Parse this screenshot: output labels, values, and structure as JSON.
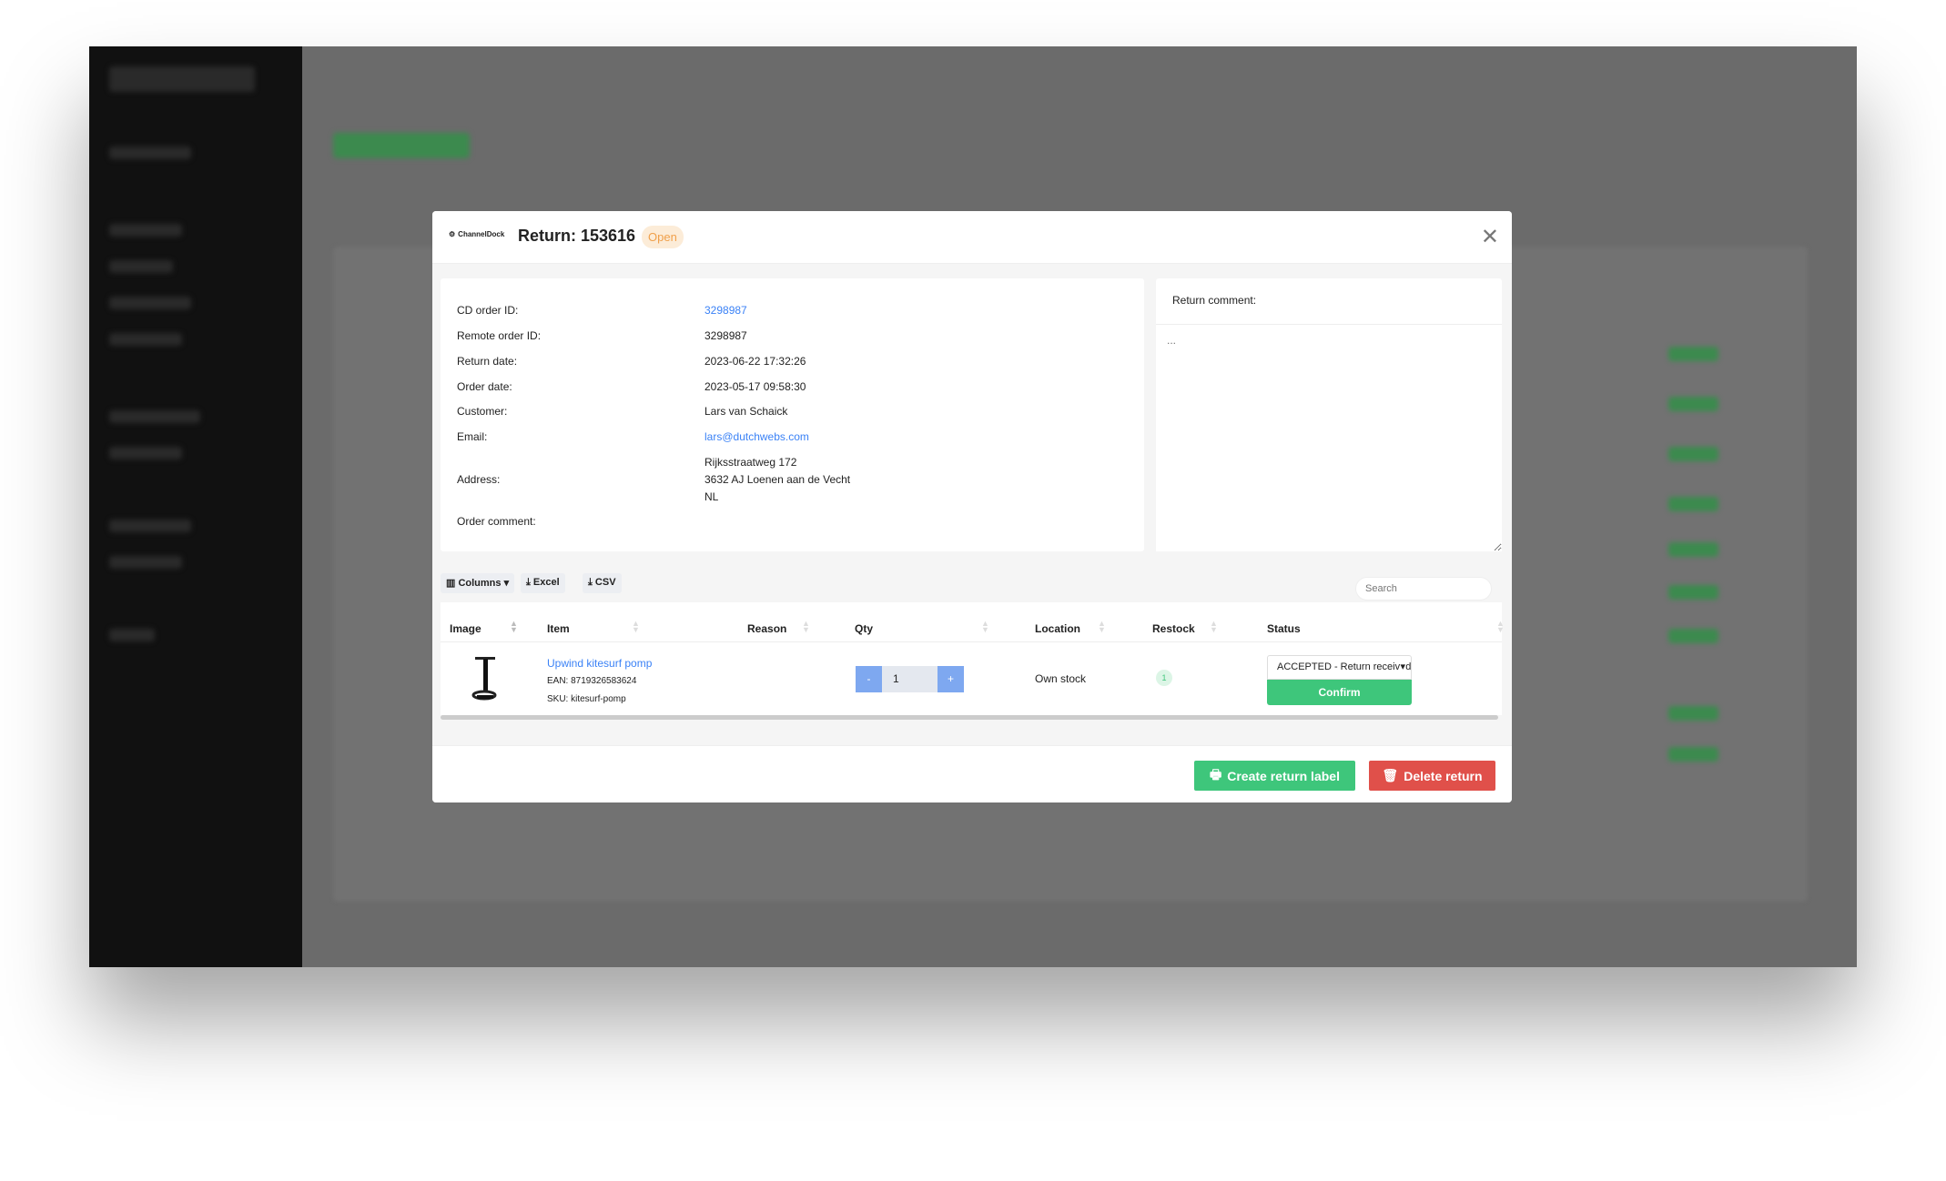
{
  "modal": {
    "logo_text": "ChannelDock",
    "title": "Return: 153616",
    "status": "Open",
    "close_icon": "close-icon"
  },
  "details": [
    {
      "label": "CD order ID:",
      "value": "3298987",
      "link": true
    },
    {
      "label": "Remote order ID:",
      "value": "3298987"
    },
    {
      "label": "Return date:",
      "value": "2023-06-22 17:32:26"
    },
    {
      "label": "Order date:",
      "value": "2023-05-17 09:58:30"
    },
    {
      "label": "Customer:",
      "value": "Lars van Schaick"
    },
    {
      "label": "Email:",
      "value": "lars@dutchwebs.com",
      "link": true
    }
  ],
  "address": {
    "label": "Address:",
    "lines": [
      "Rijksstraatweg 172",
      "3632 AJ Loenen aan de Vecht",
      "NL"
    ]
  },
  "order_comment": {
    "label": "Order comment:"
  },
  "return_comment": {
    "label": "Return comment:",
    "placeholder": "..."
  },
  "toolbar": {
    "columns": "Columns",
    "excel": "Excel",
    "csv": "CSV",
    "search_placeholder": "Search"
  },
  "table": {
    "headers": [
      "Image",
      "Item",
      "Reason",
      "Qty",
      "Location",
      "Restock",
      "Status"
    ],
    "rows": [
      {
        "item": "Upwind kitesurf pomp",
        "ean": "EAN: 8719326583624",
        "sku": "SKU: kitesurf-pomp",
        "reason": "",
        "qty": "1",
        "location": "Own stock",
        "restock": "1",
        "status": "ACCEPTED - Return received",
        "confirm": "Confirm"
      }
    ]
  },
  "footer": {
    "create_label": "Create return label",
    "delete_label": "Delete return"
  },
  "colors": {
    "green": "#3ec67b",
    "red": "#e0504a",
    "blue": "#3b82f6",
    "stepper": "#7ea8f0",
    "badge_bg": "#fcecd8",
    "badge_text": "#f0a04b"
  }
}
